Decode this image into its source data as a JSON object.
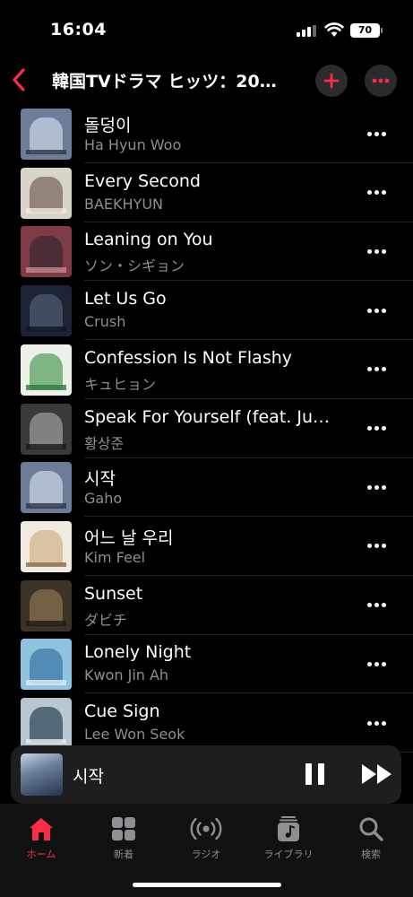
{
  "status_bar": {
    "time": "16:04",
    "battery": "70"
  },
  "nav": {
    "title": "韓国TVドラマ ヒッツ：20…"
  },
  "tracks": [
    {
      "title": "돌덩이",
      "artist": "Ha Hyun Woo",
      "art": [
        "#6d7c98",
        "#c7d2e3",
        "#2d3347"
      ]
    },
    {
      "title": "Every Second",
      "artist": "BAEKHYUN",
      "art": [
        "#d9d4ca",
        "#7a6a5c",
        "#efe9df"
      ]
    },
    {
      "title": "Leaning on You",
      "artist": "ソン・シギョン",
      "art": [
        "#7e3b46",
        "#3e2a30",
        "#c98a8e"
      ]
    },
    {
      "title": "Let Us Go",
      "artist": "Crush",
      "art": [
        "#1c2434",
        "#4d5a72",
        "#0f1420"
      ]
    },
    {
      "title": "Confession Is Not Flashy",
      "artist": "キュヒョン",
      "art": [
        "#eef1ea",
        "#5aa05f",
        "#2f7a3a"
      ]
    },
    {
      "title": "Speak For Yourself (feat. Ju…",
      "artist": "황상준",
      "art": [
        "#3a3a3a",
        "#9a9a9a",
        "#1a1a1a"
      ]
    },
    {
      "title": "시작",
      "artist": "Gaho",
      "art": [
        "#6d7c98",
        "#c7d2e3",
        "#2d3347"
      ]
    },
    {
      "title": "어느 날 우리",
      "artist": "Kim Feel",
      "art": [
        "#f1ece2",
        "#d3b48c",
        "#8c6a4a"
      ]
    },
    {
      "title": "Sunset",
      "artist": "ダビチ",
      "art": [
        "#3b3228",
        "#8a7050",
        "#1e1a14"
      ]
    },
    {
      "title": "Lonely Night",
      "artist": "Kwon Jin Ah",
      "art": [
        "#8fc3e0",
        "#3d7aa5",
        "#dbeef8"
      ]
    },
    {
      "title": "Cue Sign",
      "artist": "Lee Won Seok",
      "art": [
        "#b8c6cf",
        "#33495a",
        "#e7ecef"
      ]
    }
  ],
  "mini_player": {
    "title": "시작"
  },
  "tabs": [
    {
      "label": "ホーム",
      "icon": "home-icon",
      "active": true
    },
    {
      "label": "新着",
      "icon": "grid-icon",
      "active": false
    },
    {
      "label": "ラジオ",
      "icon": "radio-icon",
      "active": false
    },
    {
      "label": "ライブラリ",
      "icon": "library-icon",
      "active": false
    },
    {
      "label": "検索",
      "icon": "search-icon",
      "active": false
    }
  ],
  "colors": {
    "accent": "#fa2d48",
    "secondary_text": "#8e8e93",
    "background": "#000000",
    "mini_player_bg": "#1e1e20"
  }
}
